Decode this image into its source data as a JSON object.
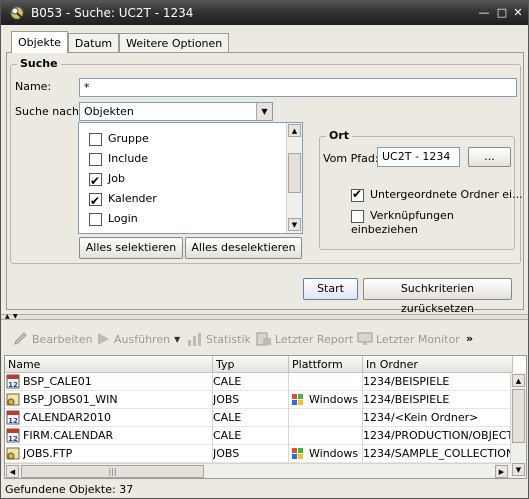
{
  "window": {
    "title": "B053 - Suche: UC2T - 1234"
  },
  "tabs": [
    "Objekte",
    "Datum",
    "Weitere Optionen"
  ],
  "suche": {
    "legend": "Suche",
    "name_label": "Name:",
    "name_value": "*",
    "suche_nach_label": "Suche nach:",
    "suche_nach_value": "Objekten",
    "types": [
      {
        "label": "Gruppe",
        "checked": false
      },
      {
        "label": "Include",
        "checked": false
      },
      {
        "label": "Job",
        "checked": true
      },
      {
        "label": "Kalender",
        "checked": true
      },
      {
        "label": "Login",
        "checked": false
      }
    ],
    "select_all": "Alles selektieren",
    "deselect_all": "Alles deselektieren"
  },
  "ort": {
    "legend": "Ort",
    "pfad_label": "Vom Pfad:",
    "pfad_value": "UC2T - 1234",
    "browse": "...",
    "sub_folders": "Untergeordnete Ordner ei...",
    "sub_folders_checked": true,
    "links": "Verknüpfungen einbeziehen",
    "links_checked": false
  },
  "actions": {
    "start": "Start",
    "reset": "Suchkriterien zurücksetzen"
  },
  "toolbar": {
    "bearbeiten": "Bearbeiten",
    "ausfuehren": "Ausführen",
    "statistik": "Statistik",
    "letzter_report": "Letzter Report",
    "letzter_monitor": "Letzter Monitor",
    "more": "»"
  },
  "table": {
    "headers": [
      "Name",
      "Typ",
      "Plattform",
      "In Ordner"
    ],
    "rows": [
      {
        "name": "BSP_CALE01",
        "typ": "CALE",
        "plattform": "",
        "ordner": "1234/BEISPIELE",
        "icon": "calendar-icon"
      },
      {
        "name": "BSP_JOBS01_WIN",
        "typ": "JOBS",
        "plattform": "Windows",
        "ordner": "1234/BEISPIELE",
        "icon": "job-icon"
      },
      {
        "name": "CALENDAR2010",
        "typ": "CALE",
        "plattform": "",
        "ordner": "1234/<Kein Ordner>",
        "icon": "calendar-icon"
      },
      {
        "name": "FIRM.CALENDAR",
        "typ": "CALE",
        "plattform": "",
        "ordner": "1234/PRODUCTION/OBJECTS",
        "icon": "calendar-icon"
      },
      {
        "name": "JOBS.FTP",
        "typ": "JOBS",
        "plattform": "Windows",
        "ordner": "1234/SAMPLE_COLLECTION",
        "icon": "job-icon"
      }
    ]
  },
  "status": "Gefundene Objekte: 37"
}
